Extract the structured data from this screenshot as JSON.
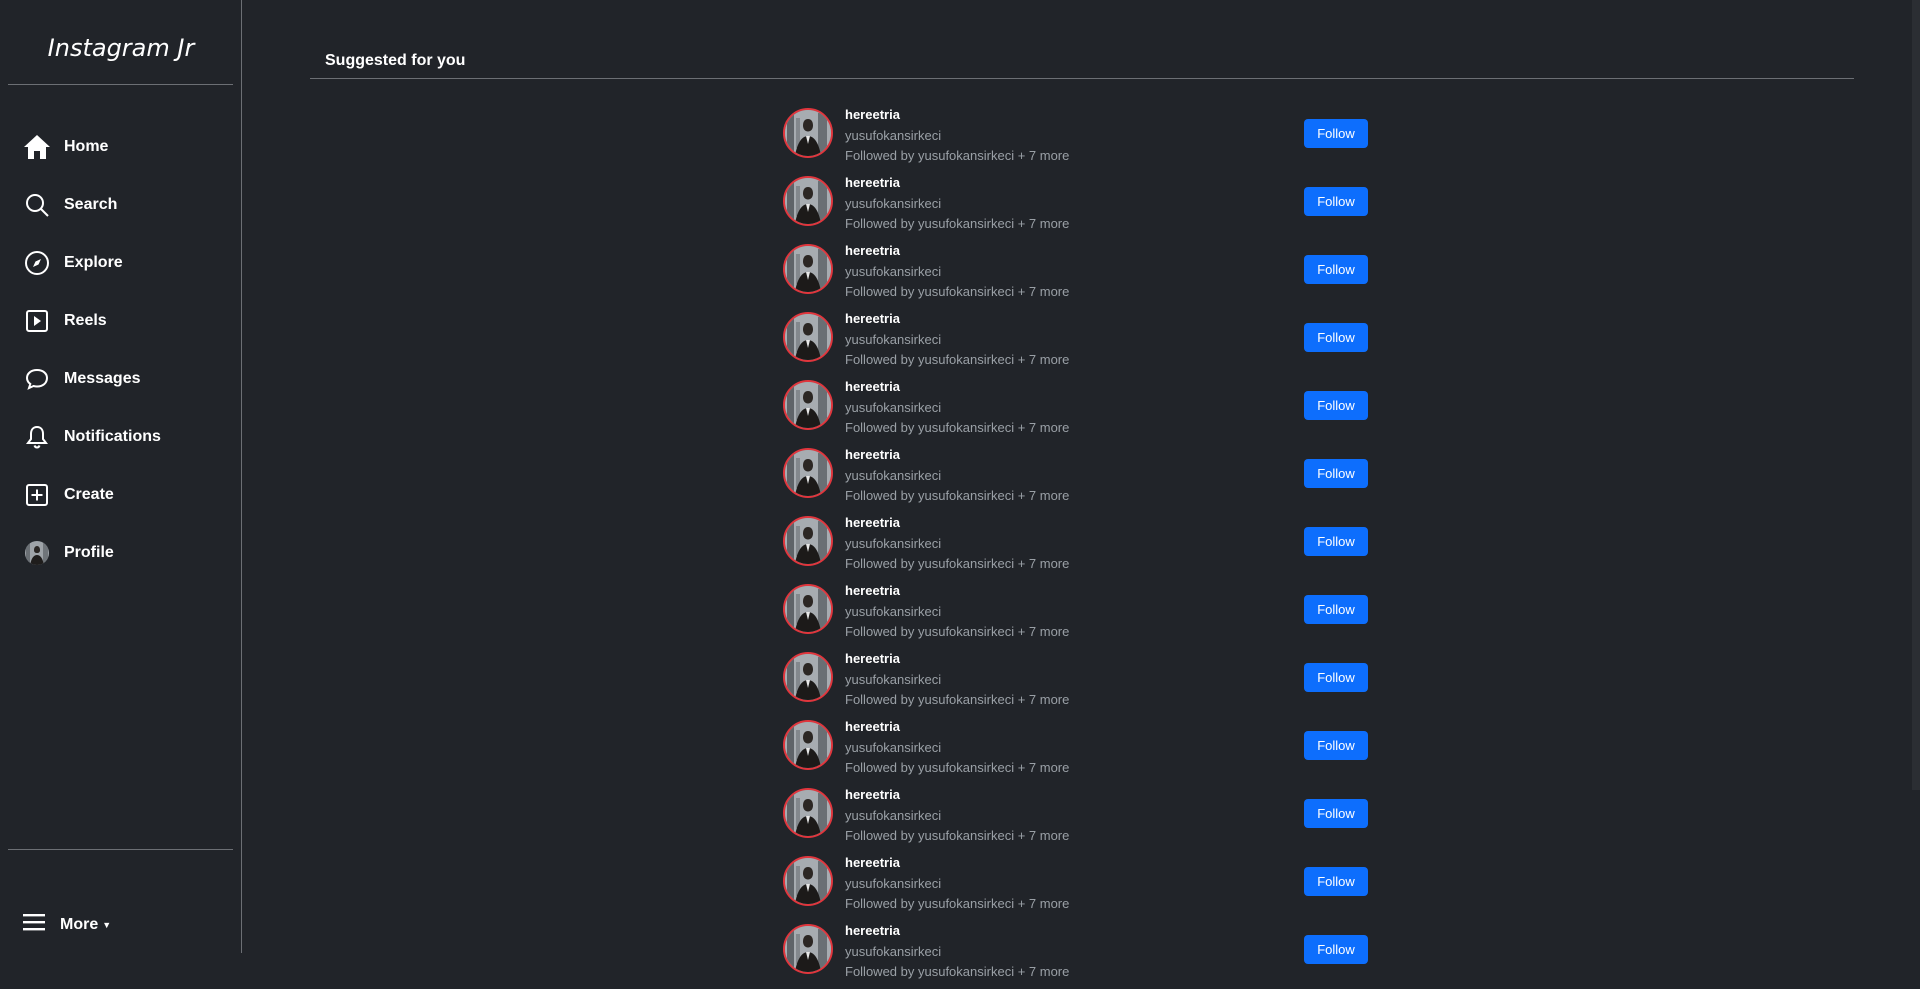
{
  "sidebar": {
    "brand": "Instagram Jr",
    "items": [
      {
        "label": "Home",
        "icon": "home-icon"
      },
      {
        "label": "Search",
        "icon": "search-icon"
      },
      {
        "label": "Explore",
        "icon": "compass-icon"
      },
      {
        "label": "Reels",
        "icon": "reels-icon"
      },
      {
        "label": "Messages",
        "icon": "message-icon"
      },
      {
        "label": "Notifications",
        "icon": "bell-icon"
      },
      {
        "label": "Create",
        "icon": "plus-square-icon"
      },
      {
        "label": "Profile",
        "icon": "avatar-icon"
      }
    ],
    "more_label": "More"
  },
  "main": {
    "section_title": "Suggested for you",
    "follow_label": "Follow",
    "suggestions": [
      {
        "username": "hereetria",
        "name": "yusufokansirkeci",
        "followed_by": "Followed by yusufokansirkeci + 7 more"
      },
      {
        "username": "hereetria",
        "name": "yusufokansirkeci",
        "followed_by": "Followed by yusufokansirkeci + 7 more"
      },
      {
        "username": "hereetria",
        "name": "yusufokansirkeci",
        "followed_by": "Followed by yusufokansirkeci + 7 more"
      },
      {
        "username": "hereetria",
        "name": "yusufokansirkeci",
        "followed_by": "Followed by yusufokansirkeci + 7 more"
      },
      {
        "username": "hereetria",
        "name": "yusufokansirkeci",
        "followed_by": "Followed by yusufokansirkeci + 7 more"
      },
      {
        "username": "hereetria",
        "name": "yusufokansirkeci",
        "followed_by": "Followed by yusufokansirkeci + 7 more"
      },
      {
        "username": "hereetria",
        "name": "yusufokansirkeci",
        "followed_by": "Followed by yusufokansirkeci + 7 more"
      },
      {
        "username": "hereetria",
        "name": "yusufokansirkeci",
        "followed_by": "Followed by yusufokansirkeci + 7 more"
      },
      {
        "username": "hereetria",
        "name": "yusufokansirkeci",
        "followed_by": "Followed by yusufokansirkeci + 7 more"
      },
      {
        "username": "hereetria",
        "name": "yusufokansirkeci",
        "followed_by": "Followed by yusufokansirkeci + 7 more"
      },
      {
        "username": "hereetria",
        "name": "yusufokansirkeci",
        "followed_by": "Followed by yusufokansirkeci + 7 more"
      },
      {
        "username": "hereetria",
        "name": "yusufokansirkeci",
        "followed_by": "Followed by yusufokansirkeci + 7 more"
      },
      {
        "username": "hereetria",
        "name": "yusufokansirkeci",
        "followed_by": "Followed by yusufokansirkeci + 7 more"
      }
    ]
  },
  "colors": {
    "background": "#212429",
    "accent": "#0d6efd",
    "avatar_ring": "#e0363d",
    "muted_text": "#9aa0a6"
  }
}
